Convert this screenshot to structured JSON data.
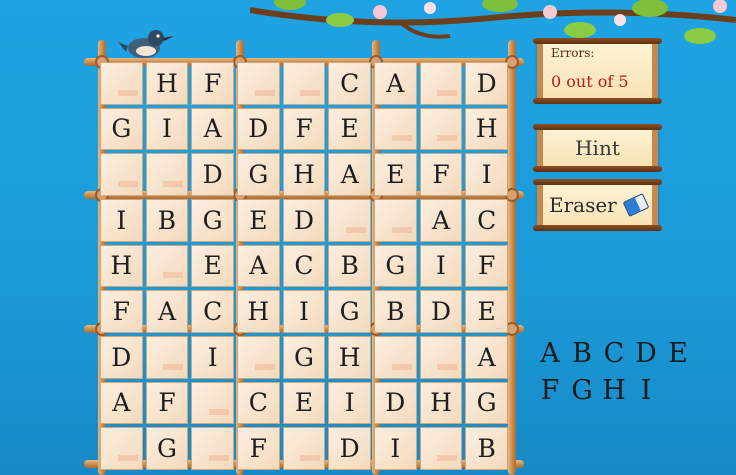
{
  "errors": {
    "label": "Errors:",
    "value": "0 out of 5"
  },
  "hint": {
    "label": "Hint"
  },
  "eraser": {
    "label": "Eraser",
    "icon": "eraser-icon"
  },
  "palette": {
    "rows": [
      [
        "A",
        "B",
        "C",
        "D",
        "E"
      ],
      [
        "F",
        "G",
        "H",
        "I"
      ]
    ]
  },
  "board": {
    "rows": [
      [
        "",
        "H",
        "F",
        "",
        "",
        "C",
        "A",
        "",
        "D"
      ],
      [
        "G",
        "I",
        "A",
        "D",
        "F",
        "E",
        "",
        "",
        "H"
      ],
      [
        "",
        "",
        "D",
        "G",
        "H",
        "A",
        "E",
        "F",
        "I"
      ],
      [
        "I",
        "B",
        "G",
        "E",
        "D",
        "",
        "",
        "A",
        "C"
      ],
      [
        "H",
        "",
        "E",
        "A",
        "C",
        "B",
        "G",
        "I",
        "F"
      ],
      [
        "F",
        "A",
        "C",
        "H",
        "I",
        "G",
        "B",
        "D",
        "E"
      ],
      [
        "D",
        "",
        "I",
        "",
        "G",
        "H",
        "",
        "",
        "A"
      ],
      [
        "A",
        "F",
        "",
        "C",
        "E",
        "I",
        "D",
        "H",
        "G"
      ],
      [
        "",
        "G",
        "",
        "F",
        "",
        "D",
        "I",
        "",
        "B"
      ]
    ]
  },
  "colors": {
    "sky": "#1fa3e2",
    "error_text": "#c01818",
    "bamboo": "#c98a4c"
  }
}
